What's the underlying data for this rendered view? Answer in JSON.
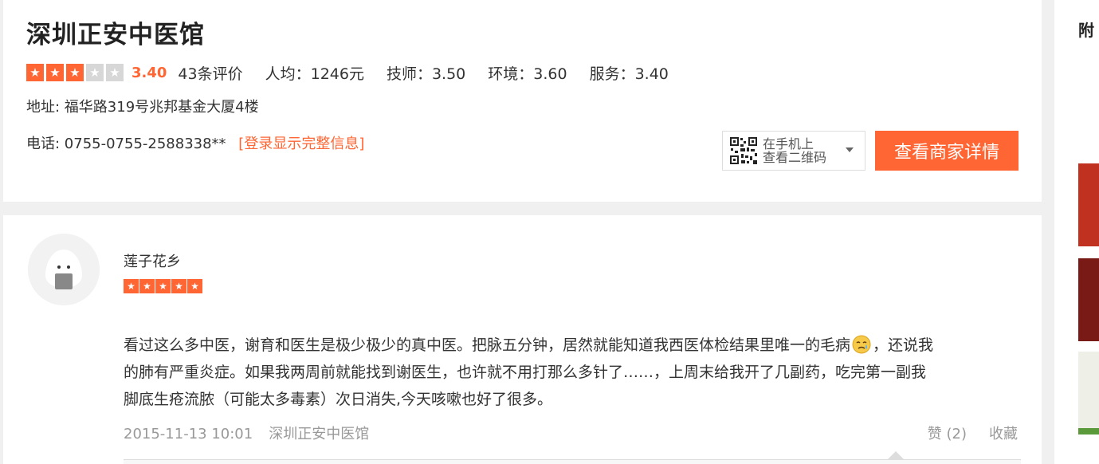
{
  "shop": {
    "name": "深圳正安中医馆",
    "rating_stars": 3,
    "rating_max": 5,
    "score": "3.40",
    "review_count": "43条评价",
    "avg_price": "人均：1246元",
    "technician": "技师：3.50",
    "environment": "环境：3.60",
    "service": "服务：3.40",
    "address": "地址: 福华路319号兆邦基金大厦4楼",
    "phone": "电话: 0755-0755-2588338**",
    "login_link": "[登录显示完整信息]",
    "qr_line1": "在手机上",
    "qr_line2": "查看二维码",
    "detail_button": "查看商家详情"
  },
  "review": {
    "username": "莲子花乡",
    "stars": 5,
    "line1": "看过这么多中医，谢育和医生是极少极少的真中医。把脉五分钟，居然就能知道我西医体检结果里唯一的毛病",
    "line1_tail": "，还说我",
    "line2": "的肺有严重炎症。如果我两周前就能找到谢医生，也许就不用打那么多针了……，上周末给我开了几副药，吃完第一副我",
    "line3": "脚底生疮流脓（可能太多毒素）次日消失,今天咳嗽也好了很多。",
    "date": "2015-11-13 10:01",
    "shop_name": "深圳正安中医馆",
    "like": "赞 (2)",
    "collect": "收藏"
  },
  "side": {
    "title": "附"
  },
  "colors": {
    "accent": "#ff6633",
    "star_off": "#d7d7d7"
  }
}
